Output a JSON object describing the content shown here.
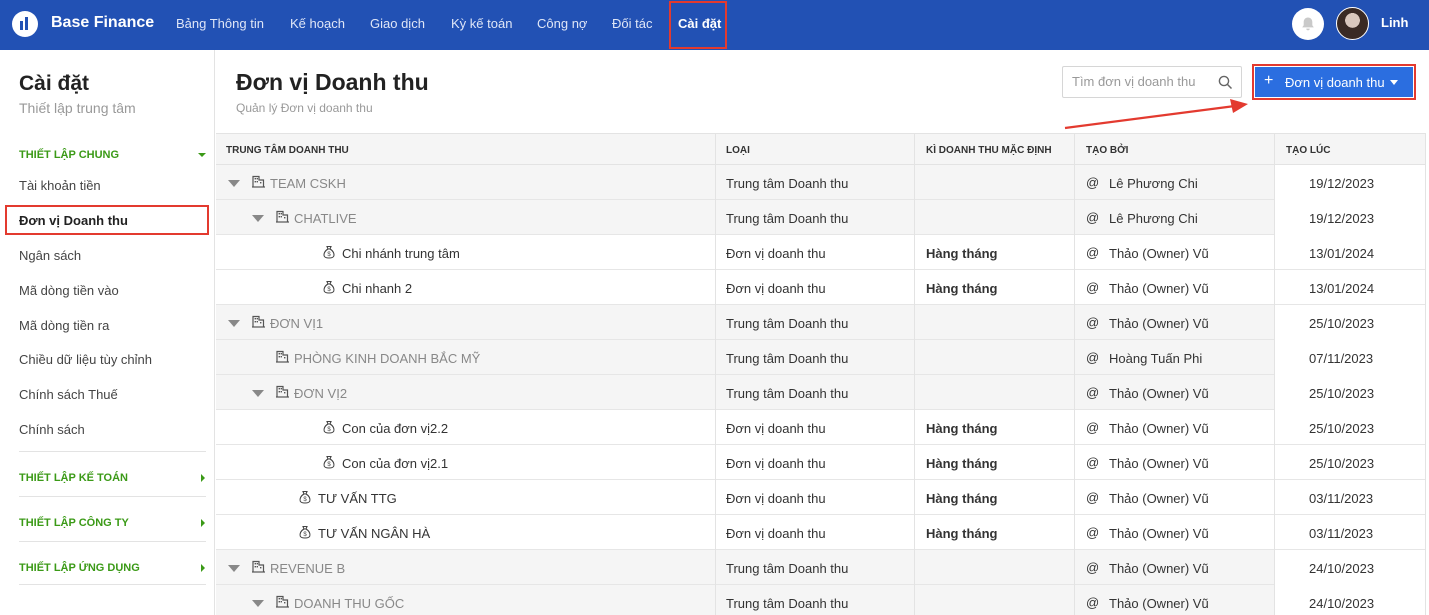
{
  "app": {
    "brand": "Base Finance",
    "nav": [
      "Bảng Thông tin",
      "Kế hoạch",
      "Giao dịch",
      "Kỳ kế toán",
      "Công nợ",
      "Đối tác",
      "Cài đặt"
    ],
    "active_nav": "Cài đặt",
    "user": "Linh"
  },
  "sidebar": {
    "title": "Cài đặt",
    "subtitle": "Thiết lập trung tâm",
    "sections": {
      "general": "THIẾT LẬP CHUNG",
      "accounting": "THIẾT LẬP KẾ TOÁN",
      "company": "THIẾT LẬP CÔNG TY",
      "app": "THIẾT LẬP ỨNG DỤNG"
    },
    "items": [
      "Tài khoản tiền",
      "Đơn vị Doanh thu",
      "Ngân sách",
      "Mã dòng tiền vào",
      "Mã dòng tiền ra",
      "Chiều dữ liệu tùy chỉnh",
      "Chính sách Thuế",
      "Chính sách"
    ]
  },
  "page": {
    "title": "Đơn vị Doanh thu",
    "subtitle": "Quản lý Đơn vị doanh thu",
    "search_placeholder": "Tìm đơn vị doanh thu",
    "add_button": "Đơn vị doanh thu"
  },
  "table": {
    "headers": [
      "TRUNG TÂM DOANH THU",
      "LOẠI",
      "KÌ DOANH THU MẶC ĐỊNH",
      "TẠO BỞI",
      "TẠO LÚC"
    ],
    "rows": [
      {
        "name": "TEAM CSKH",
        "type": "Trung tâm Doanh thu",
        "period": "",
        "by": "Lê Phương Chi",
        "at": "19/12/2023"
      },
      {
        "name": "CHATLIVE",
        "type": "Trung tâm Doanh thu",
        "period": "",
        "by": "Lê Phương Chi",
        "at": "19/12/2023"
      },
      {
        "name": "Chi nhánh trung tâm",
        "type": "Đơn vị doanh thu",
        "period": "Hàng tháng",
        "by": "Thảo (Owner) Vũ",
        "at": "13/01/2024"
      },
      {
        "name": "Chi nhanh 2",
        "type": "Đơn vị doanh thu",
        "period": "Hàng tháng",
        "by": "Thảo (Owner) Vũ",
        "at": "13/01/2024"
      },
      {
        "name": "ĐƠN VỊ1",
        "type": "Trung tâm Doanh thu",
        "period": "",
        "by": "Thảo (Owner) Vũ",
        "at": "25/10/2023"
      },
      {
        "name": "PHÒNG KINH DOANH BẮC MỸ",
        "type": "Trung tâm Doanh thu",
        "period": "",
        "by": "Hoàng Tuấn Phi",
        "at": "07/11/2023"
      },
      {
        "name": "ĐƠN VỊ2",
        "type": "Trung tâm Doanh thu",
        "period": "",
        "by": "Thảo (Owner) Vũ",
        "at": "25/10/2023"
      },
      {
        "name": "Con của đơn vị2.2",
        "type": "Đơn vị doanh thu",
        "period": "Hàng tháng",
        "by": "Thảo (Owner) Vũ",
        "at": "25/10/2023"
      },
      {
        "name": "Con của đơn vị2.1",
        "type": "Đơn vị doanh thu",
        "period": "Hàng tháng",
        "by": "Thảo (Owner) Vũ",
        "at": "25/10/2023"
      },
      {
        "name": "TƯ VẤN TTG",
        "type": "Đơn vị doanh thu",
        "period": "Hàng tháng",
        "by": "Thảo (Owner) Vũ",
        "at": "03/11/2023"
      },
      {
        "name": "TƯ VẤN NGÂN HÀ",
        "type": "Đơn vị doanh thu",
        "period": "Hàng tháng",
        "by": "Thảo (Owner) Vũ",
        "at": "03/11/2023"
      },
      {
        "name": "REVENUE B",
        "type": "Trung tâm Doanh thu",
        "period": "",
        "by": "Thảo (Owner) Vũ",
        "at": "24/10/2023"
      },
      {
        "name": "DOANH THU GỐC",
        "type": "Trung tâm Doanh thu",
        "period": "",
        "by": "Thảo (Owner) Vũ",
        "at": "24/10/2023"
      }
    ]
  },
  "colors": {
    "topbar": "#2251b4",
    "primary_button": "#2b6ee0",
    "section_green": "#3b9a17",
    "annotation_red": "#e33a2f"
  },
  "icons": {
    "logo": "bar-chart-logo-icon",
    "bell": "bell-icon",
    "search": "search-icon",
    "building": "building-icon",
    "money_bag": "money-bag-icon",
    "expand": "caret-down-icon",
    "mention": "at-icon"
  }
}
